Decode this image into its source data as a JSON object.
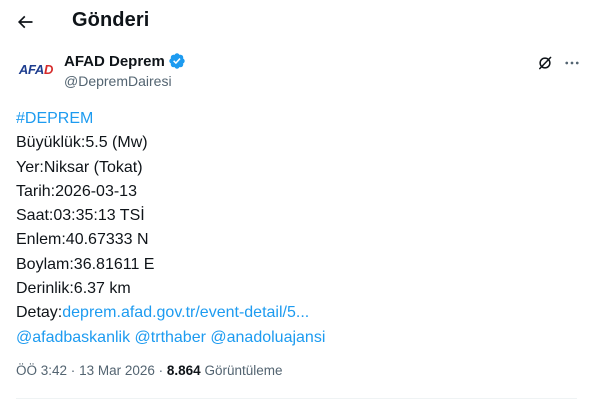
{
  "header": {
    "back_icon": "arrow-left-icon",
    "title": "Gönderi"
  },
  "author": {
    "avatar_logo": {
      "part1": "AFA",
      "part2": "D",
      "colors": {
        "primary": "#1d3d8f",
        "accent": "#d62c2c"
      }
    },
    "display_name": "AFAD Deprem",
    "verified": true,
    "verified_color": "#1d9bf0",
    "handle": "@DepremDairesi"
  },
  "actions": {
    "grok_icon": "grok-icon",
    "more_icon": "more-horizontal-icon"
  },
  "tweet": {
    "hashtag": "#DEPREM",
    "lines": [
      "Büyüklük:5.5 (Mw)",
      "Yer:Niksar (Tokat)",
      "Tarih:2026-03-13",
      "Saat:03:35:13 TSİ",
      "Enlem:40.67333 N",
      "Boylam:36.81611 E",
      "Derinlik:6.37 km"
    ],
    "detail_label": "Detay:",
    "detail_link": "deprem.afad.gov.tr/event-detail/5...",
    "mentions": [
      "@afadbaskanlik",
      "@trthaber",
      "@anadoluajansi"
    ]
  },
  "meta": {
    "time": "ÖÖ 3:42",
    "separator": "·",
    "date": "13 Mar 2026",
    "views_count": "8.864",
    "views_label": "Görüntüleme"
  },
  "colors": {
    "text": "#0f1419",
    "secondary": "#536471",
    "link": "#1d9bf0"
  }
}
